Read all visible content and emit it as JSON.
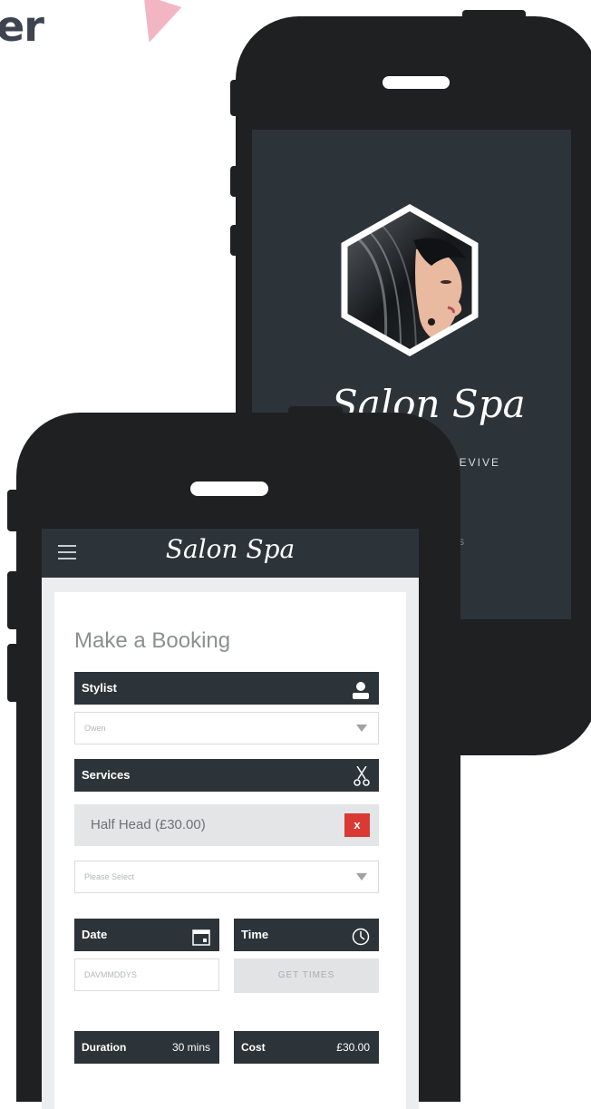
{
  "page": {
    "heading_fragment": "er"
  },
  "splash": {
    "title": "Salon Spa",
    "tagline": "REVIVE",
    "subtext": "S"
  },
  "app": {
    "title": "Salon Spa",
    "booking_title": "Make a Booking",
    "stylist": {
      "label": "Stylist",
      "selected": "Owen"
    },
    "services": {
      "label": "Services",
      "items": [
        {
          "name": "Half Head (£30.00)",
          "remove_label": "x"
        }
      ],
      "select_placeholder": "Please Select"
    },
    "date": {
      "label": "Date",
      "value": "DAVMMDDYS"
    },
    "time": {
      "label": "Time",
      "button": "GET TIMES"
    },
    "summary": {
      "duration_label": "Duration",
      "duration_value": "30 mins",
      "cost_label": "Cost",
      "cost_value": "£30.00"
    }
  },
  "colors": {
    "bar": "#2d3439",
    "phone": "#1f2022",
    "danger": "#d93a34",
    "accent_pink": "#f2b6c3"
  },
  "icons": [
    "menu-icon",
    "user-icon",
    "scissors-icon",
    "calendar-icon",
    "clock-icon",
    "filter-icon"
  ]
}
